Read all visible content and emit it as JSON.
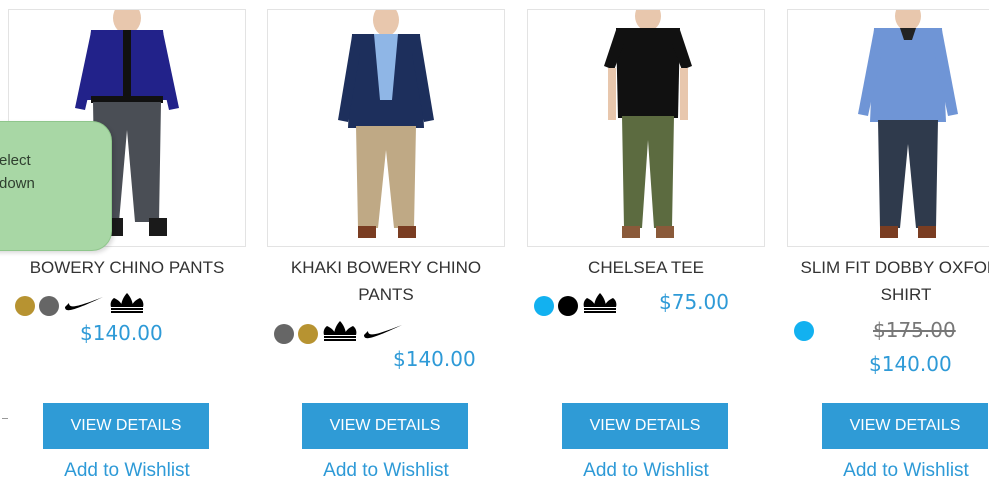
{
  "products": [
    {
      "name": "BOWERY CHINO PANTS",
      "swatches": [
        "#b79331",
        "#666666"
      ],
      "brands": [
        "nike-swoosh-icon",
        "adidas-trefoil-icon"
      ],
      "price": "$140.00",
      "old_price": "",
      "details_label": "VIEW DETAILS",
      "wishlist_label": "Add to Wishlist"
    },
    {
      "name": "KHAKI BOWERY CHINO PANTS",
      "swatches": [
        "#666666",
        "#b79331"
      ],
      "brands": [
        "adidas-trefoil-icon",
        "nike-swoosh-icon"
      ],
      "price": "$140.00",
      "old_price": "",
      "details_label": "VIEW DETAILS",
      "wishlist_label": "Add to Wishlist"
    },
    {
      "name": "CHELSEA TEE",
      "swatches": [
        "#12b1f0",
        "#000000"
      ],
      "brands": [
        "adidas-trefoil-icon"
      ],
      "price": "$75.00",
      "old_price": "",
      "details_label": "VIEW DETAILS",
      "wishlist_label": "Add to Wishlist"
    },
    {
      "name": "SLIM FIT DOBBY OXFORD SHIRT",
      "swatches": [
        "#12b1f0"
      ],
      "brands": [],
      "price": "$140.00",
      "old_price": "$175.00",
      "details_label": "VIEW DETAILS",
      "wishlist_label": "Add to Wishlist"
    }
  ],
  "tooltip": {
    "text": "elect\ndown"
  },
  "colors": {
    "accent": "#2f9bd6",
    "tooltip_bg": "#a8d7a5"
  }
}
